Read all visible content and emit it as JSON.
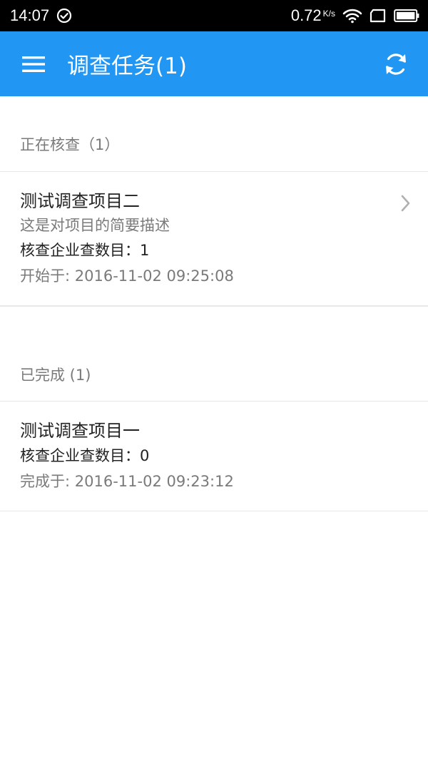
{
  "status_bar": {
    "time": "14:07",
    "speed": "0.72",
    "speed_unit": "K/s",
    "icons": [
      "check-circle-icon",
      "wifi-icon",
      "sim-icon",
      "battery-icon"
    ]
  },
  "app_bar": {
    "title": "调查任务(1)",
    "background": "#2196f3",
    "icons": [
      "menu-icon",
      "refresh-icon"
    ]
  },
  "sections": [
    {
      "header": "正在核查（1）",
      "items": [
        {
          "title": "测试调查项目二",
          "description": "这是对项目的简要描述",
          "count_label": "核查企业查数目：",
          "count": "1",
          "time_label": "开始于: ",
          "time": "2016-11-02 09:25:08",
          "has_chevron": true
        }
      ]
    },
    {
      "header": "已完成 (1)",
      "items": [
        {
          "title": "测试调查项目一",
          "count_label": "核查企业查数目：",
          "count": "0",
          "time_label": "完成于: ",
          "time": "2016-11-02 09:23:12",
          "has_chevron": false
        }
      ]
    }
  ]
}
